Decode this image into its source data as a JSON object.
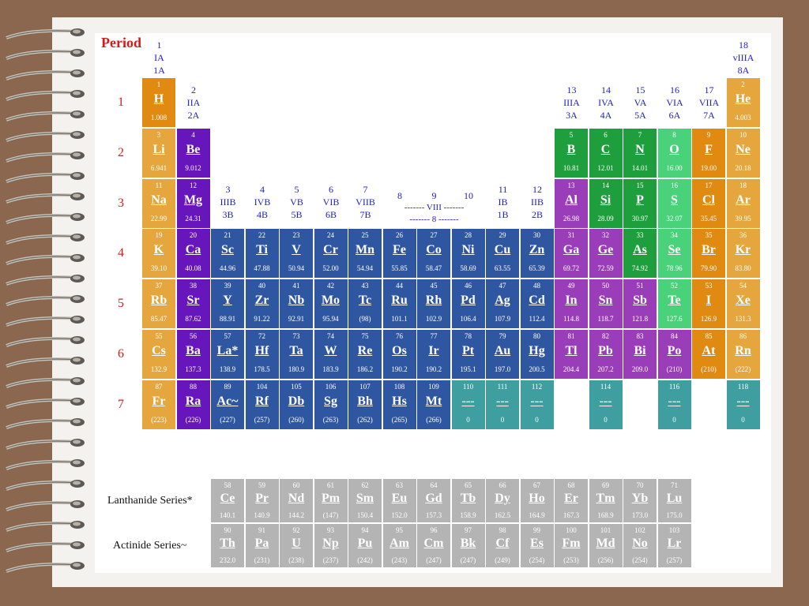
{
  "title": "Period",
  "periods": [
    "1",
    "2",
    "3",
    "4",
    "5",
    "6",
    "7"
  ],
  "colors": {
    "orange": "#e08a12",
    "lightorange": "#e5a73d",
    "purple": "#6616bb",
    "blue": "#2f57a1",
    "magenta": "#9a3db8",
    "green": "#1e9e3c",
    "lightgreen": "#4ad27a",
    "teal": "#3f9ea0",
    "gray": "#b4b4b4"
  },
  "group_labels": [
    {
      "text": "1\nIA\n1A",
      "col": 1,
      "row": 0
    },
    {
      "text": "2\nIIA\n2A",
      "col": 2,
      "row": 1
    },
    {
      "text": "3\nIIIB\n3B",
      "col": 3,
      "row": 3
    },
    {
      "text": "4\nIVB\n4B",
      "col": 4,
      "row": 3
    },
    {
      "text": "5\nVB\n5B",
      "col": 5,
      "row": 3
    },
    {
      "text": "6\nVIB\n6B",
      "col": 6,
      "row": 3
    },
    {
      "text": "7\nVIIB\n7B",
      "col": 7,
      "row": 3
    },
    {
      "text": "8",
      "col": 8,
      "row": 3
    },
    {
      "text": "9",
      "col": 9,
      "row": 3
    },
    {
      "text": "10",
      "col": 10,
      "row": 3
    },
    {
      "text": "11\nIB\n1B",
      "col": 11,
      "row": 3
    },
    {
      "text": "12\nIIB\n2B",
      "col": 12,
      "row": 3
    },
    {
      "text": "13\nIIIA\n3A",
      "col": 13,
      "row": 1
    },
    {
      "text": "14\nIVA\n4A",
      "col": 14,
      "row": 1
    },
    {
      "text": "15\nVA\n5A",
      "col": 15,
      "row": 1
    },
    {
      "text": "16\nVIA\n6A",
      "col": 16,
      "row": 1
    },
    {
      "text": "17\nVIIA\n7A",
      "col": 17,
      "row": 1
    },
    {
      "text": "18\nvIIIA\n8A",
      "col": 18,
      "row": 0
    }
  ],
  "viii_label": "------- VIII -------\n------- 8 -------",
  "elements": [
    {
      "n": "1",
      "s": "H",
      "m": "1.008",
      "r": 1,
      "c": 1,
      "k": "orange"
    },
    {
      "n": "2",
      "s": "He",
      "m": "4.003",
      "r": 1,
      "c": 18,
      "k": "lightorange"
    },
    {
      "n": "3",
      "s": "Li",
      "m": "6.941",
      "r": 2,
      "c": 1,
      "k": "lightorange"
    },
    {
      "n": "4",
      "s": "Be",
      "m": "9.012",
      "r": 2,
      "c": 2,
      "k": "purple"
    },
    {
      "n": "5",
      "s": "B",
      "m": "10.81",
      "r": 2,
      "c": 13,
      "k": "green"
    },
    {
      "n": "6",
      "s": "C",
      "m": "12.01",
      "r": 2,
      "c": 14,
      "k": "green"
    },
    {
      "n": "7",
      "s": "N",
      "m": "14.01",
      "r": 2,
      "c": 15,
      "k": "green"
    },
    {
      "n": "8",
      "s": "O",
      "m": "16.00",
      "r": 2,
      "c": 16,
      "k": "lightgreen"
    },
    {
      "n": "9",
      "s": "F",
      "m": "19.00",
      "r": 2,
      "c": 17,
      "k": "orange"
    },
    {
      "n": "10",
      "s": "Ne",
      "m": "20.18",
      "r": 2,
      "c": 18,
      "k": "lightorange"
    },
    {
      "n": "11",
      "s": "Na",
      "m": "22.99",
      "r": 3,
      "c": 1,
      "k": "lightorange"
    },
    {
      "n": "12",
      "s": "Mg",
      "m": "24.31",
      "r": 3,
      "c": 2,
      "k": "purple"
    },
    {
      "n": "13",
      "s": "Al",
      "m": "26.98",
      "r": 3,
      "c": 13,
      "k": "magenta"
    },
    {
      "n": "14",
      "s": "Si",
      "m": "28.09",
      "r": 3,
      "c": 14,
      "k": "green"
    },
    {
      "n": "15",
      "s": "P",
      "m": "30.97",
      "r": 3,
      "c": 15,
      "k": "green"
    },
    {
      "n": "16",
      "s": "S",
      "m": "32.07",
      "r": 3,
      "c": 16,
      "k": "lightgreen"
    },
    {
      "n": "17",
      "s": "Cl",
      "m": "35.45",
      "r": 3,
      "c": 17,
      "k": "orange"
    },
    {
      "n": "18",
      "s": "Ar",
      "m": "39.95",
      "r": 3,
      "c": 18,
      "k": "lightorange"
    },
    {
      "n": "19",
      "s": "K",
      "m": "39.10",
      "r": 4,
      "c": 1,
      "k": "lightorange"
    },
    {
      "n": "20",
      "s": "Ca",
      "m": "40.08",
      "r": 4,
      "c": 2,
      "k": "purple"
    },
    {
      "n": "21",
      "s": "Sc",
      "m": "44.96",
      "r": 4,
      "c": 3,
      "k": "blue"
    },
    {
      "n": "22",
      "s": "Ti",
      "m": "47.88",
      "r": 4,
      "c": 4,
      "k": "blue"
    },
    {
      "n": "23",
      "s": "V",
      "m": "50.94",
      "r": 4,
      "c": 5,
      "k": "blue"
    },
    {
      "n": "24",
      "s": "Cr",
      "m": "52.00",
      "r": 4,
      "c": 6,
      "k": "blue"
    },
    {
      "n": "25",
      "s": "Mn",
      "m": "54.94",
      "r": 4,
      "c": 7,
      "k": "blue"
    },
    {
      "n": "26",
      "s": "Fe",
      "m": "55.85",
      "r": 4,
      "c": 8,
      "k": "blue"
    },
    {
      "n": "27",
      "s": "Co",
      "m": "58.47",
      "r": 4,
      "c": 9,
      "k": "blue"
    },
    {
      "n": "28",
      "s": "Ni",
      "m": "58.69",
      "r": 4,
      "c": 10,
      "k": "blue"
    },
    {
      "n": "29",
      "s": "Cu",
      "m": "63.55",
      "r": 4,
      "c": 11,
      "k": "blue"
    },
    {
      "n": "30",
      "s": "Zn",
      "m": "65.39",
      "r": 4,
      "c": 12,
      "k": "blue"
    },
    {
      "n": "31",
      "s": "Ga",
      "m": "69.72",
      "r": 4,
      "c": 13,
      "k": "magenta"
    },
    {
      "n": "32",
      "s": "Ge",
      "m": "72.59",
      "r": 4,
      "c": 14,
      "k": "magenta"
    },
    {
      "n": "33",
      "s": "As",
      "m": "74.92",
      "r": 4,
      "c": 15,
      "k": "green"
    },
    {
      "n": "34",
      "s": "Se",
      "m": "78.96",
      "r": 4,
      "c": 16,
      "k": "lightgreen"
    },
    {
      "n": "35",
      "s": "Br",
      "m": "79.90",
      "r": 4,
      "c": 17,
      "k": "orange"
    },
    {
      "n": "36",
      "s": "Kr",
      "m": "83.80",
      "r": 4,
      "c": 18,
      "k": "lightorange"
    },
    {
      "n": "37",
      "s": "Rb",
      "m": "85.47",
      "r": 5,
      "c": 1,
      "k": "lightorange"
    },
    {
      "n": "38",
      "s": "Sr",
      "m": "87.62",
      "r": 5,
      "c": 2,
      "k": "purple"
    },
    {
      "n": "39",
      "s": "Y",
      "m": "88.91",
      "r": 5,
      "c": 3,
      "k": "blue"
    },
    {
      "n": "40",
      "s": "Zr",
      "m": "91.22",
      "r": 5,
      "c": 4,
      "k": "blue"
    },
    {
      "n": "41",
      "s": "Nb",
      "m": "92.91",
      "r": 5,
      "c": 5,
      "k": "blue"
    },
    {
      "n": "42",
      "s": "Mo",
      "m": "95.94",
      "r": 5,
      "c": 6,
      "k": "blue"
    },
    {
      "n": "43",
      "s": "Tc",
      "m": "(98)",
      "r": 5,
      "c": 7,
      "k": "blue"
    },
    {
      "n": "44",
      "s": "Ru",
      "m": "101.1",
      "r": 5,
      "c": 8,
      "k": "blue"
    },
    {
      "n": "45",
      "s": "Rh",
      "m": "102.9",
      "r": 5,
      "c": 9,
      "k": "blue"
    },
    {
      "n": "46",
      "s": "Pd",
      "m": "106.4",
      "r": 5,
      "c": 10,
      "k": "blue"
    },
    {
      "n": "47",
      "s": "Ag",
      "m": "107.9",
      "r": 5,
      "c": 11,
      "k": "blue"
    },
    {
      "n": "48",
      "s": "Cd",
      "m": "112.4",
      "r": 5,
      "c": 12,
      "k": "blue"
    },
    {
      "n": "49",
      "s": "In",
      "m": "114.8",
      "r": 5,
      "c": 13,
      "k": "magenta"
    },
    {
      "n": "50",
      "s": "Sn",
      "m": "118.7",
      "r": 5,
      "c": 14,
      "k": "magenta"
    },
    {
      "n": "51",
      "s": "Sb",
      "m": "121.8",
      "r": 5,
      "c": 15,
      "k": "magenta"
    },
    {
      "n": "52",
      "s": "Te",
      "m": "127.6",
      "r": 5,
      "c": 16,
      "k": "lightgreen"
    },
    {
      "n": "53",
      "s": "I",
      "m": "126.9",
      "r": 5,
      "c": 17,
      "k": "orange"
    },
    {
      "n": "54",
      "s": "Xe",
      "m": "131.3",
      "r": 5,
      "c": 18,
      "k": "lightorange"
    },
    {
      "n": "55",
      "s": "Cs",
      "m": "132.9",
      "r": 6,
      "c": 1,
      "k": "lightorange"
    },
    {
      "n": "56",
      "s": "Ba",
      "m": "137.3",
      "r": 6,
      "c": 2,
      "k": "purple"
    },
    {
      "n": "57",
      "s": "La*",
      "m": "138.9",
      "r": 6,
      "c": 3,
      "k": "blue"
    },
    {
      "n": "72",
      "s": "Hf",
      "m": "178.5",
      "r": 6,
      "c": 4,
      "k": "blue"
    },
    {
      "n": "73",
      "s": "Ta",
      "m": "180.9",
      "r": 6,
      "c": 5,
      "k": "blue"
    },
    {
      "n": "74",
      "s": "W",
      "m": "183.9",
      "r": 6,
      "c": 6,
      "k": "blue"
    },
    {
      "n": "75",
      "s": "Re",
      "m": "186.2",
      "r": 6,
      "c": 7,
      "k": "blue"
    },
    {
      "n": "76",
      "s": "Os",
      "m": "190.2",
      "r": 6,
      "c": 8,
      "k": "blue"
    },
    {
      "n": "77",
      "s": "Ir",
      "m": "190.2",
      "r": 6,
      "c": 9,
      "k": "blue"
    },
    {
      "n": "78",
      "s": "Pt",
      "m": "195.1",
      "r": 6,
      "c": 10,
      "k": "blue"
    },
    {
      "n": "79",
      "s": "Au",
      "m": "197.0",
      "r": 6,
      "c": 11,
      "k": "blue"
    },
    {
      "n": "80",
      "s": "Hg",
      "m": "200.5",
      "r": 6,
      "c": 12,
      "k": "blue"
    },
    {
      "n": "81",
      "s": "Tl",
      "m": "204.4",
      "r": 6,
      "c": 13,
      "k": "magenta"
    },
    {
      "n": "82",
      "s": "Pb",
      "m": "207.2",
      "r": 6,
      "c": 14,
      "k": "magenta"
    },
    {
      "n": "83",
      "s": "Bi",
      "m": "209.0",
      "r": 6,
      "c": 15,
      "k": "magenta"
    },
    {
      "n": "84",
      "s": "Po",
      "m": "(210)",
      "r": 6,
      "c": 16,
      "k": "magenta"
    },
    {
      "n": "85",
      "s": "At",
      "m": "(210)",
      "r": 6,
      "c": 17,
      "k": "orange"
    },
    {
      "n": "86",
      "s": "Rn",
      "m": "(222)",
      "r": 6,
      "c": 18,
      "k": "lightorange"
    },
    {
      "n": "87",
      "s": "Fr",
      "m": "(223)",
      "r": 7,
      "c": 1,
      "k": "lightorange"
    },
    {
      "n": "88",
      "s": "Ra",
      "m": "(226)",
      "r": 7,
      "c": 2,
      "k": "purple"
    },
    {
      "n": "89",
      "s": "Ac~",
      "m": "(227)",
      "r": 7,
      "c": 3,
      "k": "blue"
    },
    {
      "n": "104",
      "s": "Rf",
      "m": "(257)",
      "r": 7,
      "c": 4,
      "k": "blue"
    },
    {
      "n": "105",
      "s": "Db",
      "m": "(260)",
      "r": 7,
      "c": 5,
      "k": "blue"
    },
    {
      "n": "106",
      "s": "Sg",
      "m": "(263)",
      "r": 7,
      "c": 6,
      "k": "blue"
    },
    {
      "n": "107",
      "s": "Bh",
      "m": "(262)",
      "r": 7,
      "c": 7,
      "k": "blue"
    },
    {
      "n": "108",
      "s": "Hs",
      "m": "(265)",
      "r": 7,
      "c": 8,
      "k": "blue"
    },
    {
      "n": "109",
      "s": "Mt",
      "m": "(266)",
      "r": 7,
      "c": 9,
      "k": "blue"
    },
    {
      "n": "110",
      "s": "---",
      "m": "0",
      "r": 7,
      "c": 10,
      "k": "teal"
    },
    {
      "n": "111",
      "s": "---",
      "m": "0",
      "r": 7,
      "c": 11,
      "k": "teal"
    },
    {
      "n": "112",
      "s": "---",
      "m": "0",
      "r": 7,
      "c": 12,
      "k": "teal"
    },
    {
      "n": "114",
      "s": "---",
      "m": "0",
      "r": 7,
      "c": 14,
      "k": "teal"
    },
    {
      "n": "116",
      "s": "---",
      "m": "0",
      "r": 7,
      "c": 16,
      "k": "teal"
    },
    {
      "n": "118",
      "s": "---",
      "m": "0",
      "r": 7,
      "c": 18,
      "k": "teal"
    }
  ],
  "series": [
    {
      "label": "Lanthanide Series*",
      "elements": [
        {
          "n": "58",
          "s": "Ce",
          "m": "140.1"
        },
        {
          "n": "59",
          "s": "Pr",
          "m": "140.9"
        },
        {
          "n": "60",
          "s": "Nd",
          "m": "144.2"
        },
        {
          "n": "61",
          "s": "Pm",
          "m": "(147)"
        },
        {
          "n": "62",
          "s": "Sm",
          "m": "150.4"
        },
        {
          "n": "63",
          "s": "Eu",
          "m": "152.0"
        },
        {
          "n": "64",
          "s": "Gd",
          "m": "157.3"
        },
        {
          "n": "65",
          "s": "Tb",
          "m": "158.9"
        },
        {
          "n": "66",
          "s": "Dy",
          "m": "162.5"
        },
        {
          "n": "67",
          "s": "Ho",
          "m": "164.9"
        },
        {
          "n": "68",
          "s": "Er",
          "m": "167.3"
        },
        {
          "n": "69",
          "s": "Tm",
          "m": "168.9"
        },
        {
          "n": "70",
          "s": "Yb",
          "m": "173.0"
        },
        {
          "n": "71",
          "s": "Lu",
          "m": "175.0"
        }
      ]
    },
    {
      "label": "Actinide Series~",
      "elements": [
        {
          "n": "90",
          "s": "Th",
          "m": "232.0"
        },
        {
          "n": "91",
          "s": "Pa",
          "m": "(231)"
        },
        {
          "n": "92",
          "s": "U",
          "m": "(238)"
        },
        {
          "n": "93",
          "s": "Np",
          "m": "(237)"
        },
        {
          "n": "94",
          "s": "Pu",
          "m": "(242)"
        },
        {
          "n": "95",
          "s": "Am",
          "m": "(243)"
        },
        {
          "n": "96",
          "s": "Cm",
          "m": "(247)"
        },
        {
          "n": "97",
          "s": "Bk",
          "m": "(247)"
        },
        {
          "n": "98",
          "s": "Cf",
          "m": "(249)"
        },
        {
          "n": "99",
          "s": "Es",
          "m": "(254)"
        },
        {
          "n": "100",
          "s": "Fm",
          "m": "(253)"
        },
        {
          "n": "101",
          "s": "Md",
          "m": "(256)"
        },
        {
          "n": "102",
          "s": "No",
          "m": "(254)"
        },
        {
          "n": "103",
          "s": "Lr",
          "m": "(257)"
        }
      ]
    }
  ]
}
